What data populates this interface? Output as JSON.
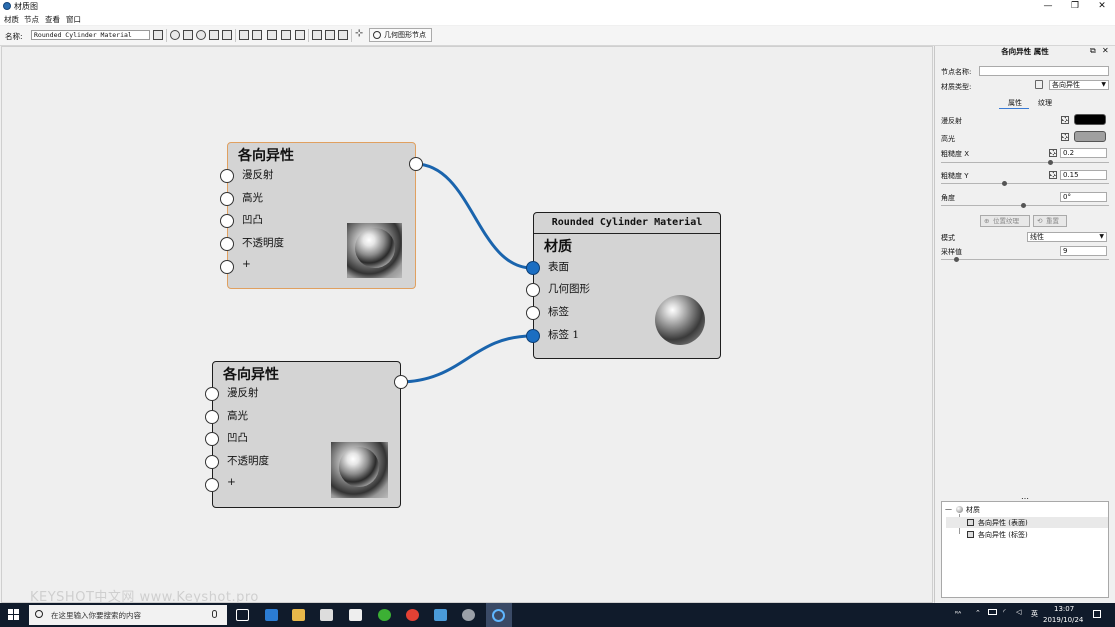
{
  "window": {
    "title": "材质图",
    "min": "—",
    "max": "❐",
    "close": "✕"
  },
  "menu": [
    "材质",
    "节点",
    "查看",
    "窗口"
  ],
  "toolbar": {
    "name_label": "名称:",
    "name_value": "Rounded Cylinder Material",
    "geometry_button": "几何图形节点"
  },
  "nodes": {
    "aniso1": {
      "title": "各向异性",
      "ports": [
        "漫反射",
        "高光",
        "凹凸",
        "不透明度",
        "+"
      ]
    },
    "aniso2": {
      "title": "各向异性",
      "ports": [
        "漫反射",
        "高光",
        "凹凸",
        "不透明度",
        "+"
      ]
    },
    "material": {
      "header": "Rounded Cylinder Material",
      "title": "材质",
      "ports": [
        "表面",
        "几何图形",
        "标签",
        "标签 1"
      ]
    }
  },
  "watermark": "KEYSHOT中文网 www.Keyshot.pro",
  "panel": {
    "header": "各向异性 属性",
    "node_name_label": "节点名称:",
    "node_name_value": "",
    "material_type_label": "材质类型:",
    "material_type_value": "各向异性",
    "tabs": [
      "属性",
      "纹理"
    ],
    "diffuse_label": "漫反射",
    "diffuse_color": "#000000",
    "specular_label": "高光",
    "specular_color": "#a0a0a0",
    "roughness_x_label": "粗糙度 X",
    "roughness_x_value": "0.2",
    "roughness_y_label": "粗糙度 Y",
    "roughness_y_value": "0.15",
    "angle_label": "角度",
    "angle_value": "0°",
    "position_texture_button": "位置纹理",
    "reset_button": "重置",
    "mode_label": "模式",
    "mode_value": "线性",
    "samples_label": "采样值",
    "samples_value": "9",
    "divider": "…"
  },
  "tree": {
    "root": "材质",
    "items": [
      "各向异性 (表面)",
      "各向异性 (标签)"
    ]
  },
  "taskbar": {
    "search_placeholder": "在这里输入你要搜索的内容",
    "time": "13:07",
    "date": "2019/10/24",
    "ime": "英",
    "person": "ᴿᴬ"
  }
}
